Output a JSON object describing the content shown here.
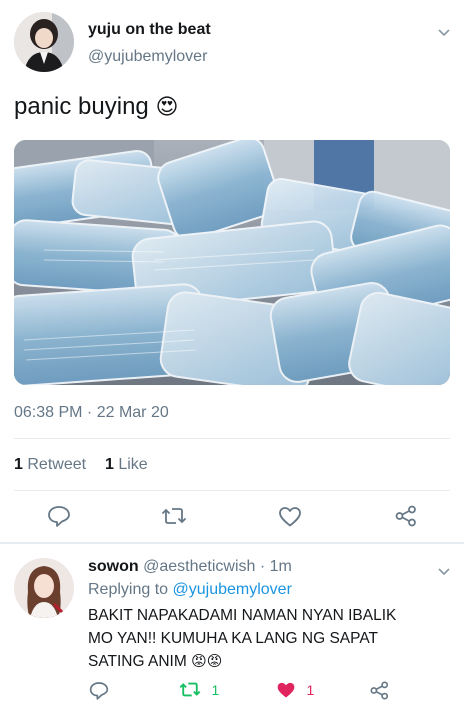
{
  "tweet": {
    "display_name": "yuju on the beat",
    "handle": "@yujubemylover",
    "text": "panic buying",
    "emoji": "😍",
    "timestamp": "06:38 PM · 22 Mar 20",
    "stats": {
      "retweet_count": "1",
      "retweet_label": "Retweet",
      "like_count": "1",
      "like_label": "Like"
    },
    "image_icon": "face-masks-photo",
    "avatar_icon": "user-avatar"
  },
  "reply": {
    "display_name": "sowon",
    "handle": "@aestheticwish",
    "time": "· 1m",
    "replying_label": "Replying to",
    "replying_handle": "@yujubemylover",
    "lines": [
      "BAKIT NAPAKADAMI NAMAN NYAN IBALIK",
      "MO YAN!! KUMUHA KA LANG NG SAPAT",
      "SATING ANIM"
    ],
    "emoji": "😡😡",
    "retweet_count": "1",
    "like_count": "1",
    "avatar_icon": "user-avatar"
  },
  "colors": {
    "accent": "#1b95e0",
    "retweet_green": "#17bf63",
    "like_red": "#e0245e",
    "muted": "#657786"
  }
}
